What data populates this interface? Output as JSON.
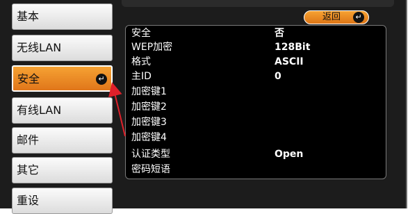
{
  "sidebar": {
    "items": [
      {
        "label": "基本"
      },
      {
        "label": "无线LAN"
      },
      {
        "label": "安全",
        "selected": true,
        "enter_icon": "enter-icon"
      },
      {
        "label": "有线LAN"
      },
      {
        "label": "邮件"
      },
      {
        "label": "其它"
      },
      {
        "label": "重设"
      }
    ]
  },
  "header": {
    "back_label": "返回",
    "back_icon": "enter-icon"
  },
  "settings": {
    "rows": [
      {
        "label": "安全",
        "value": "否"
      },
      {
        "label": "WEP加密",
        "value": "128Bit"
      },
      {
        "label": "格式",
        "value": "ASCII"
      },
      {
        "label": "主ID",
        "value": "0"
      },
      {
        "label": "加密键1",
        "value": ""
      },
      {
        "label": "加密键2",
        "value": ""
      },
      {
        "label": "加密键3",
        "value": ""
      },
      {
        "label": "加密键4",
        "value": ""
      },
      {
        "label": "认证类型",
        "value": "Open"
      },
      {
        "label": "密码短语",
        "value": ""
      }
    ]
  },
  "colors": {
    "accent": "#f19a2e",
    "panel_bg": "#000000",
    "frame_bg": "#1c1c1c",
    "annotation_arrow": "#e0202a"
  }
}
